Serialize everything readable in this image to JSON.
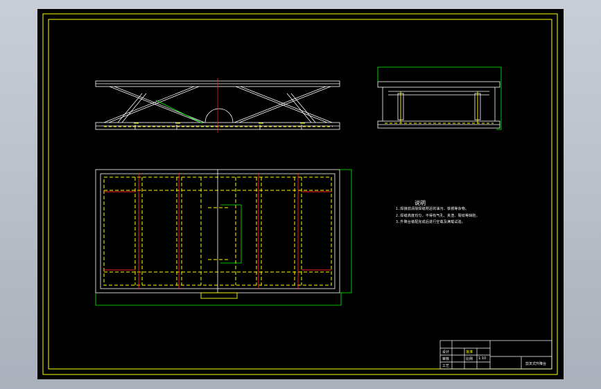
{
  "viewport": {
    "background": "#000000",
    "frame_color": "#ffff00"
  },
  "notes": {
    "title": "说明",
    "lines": [
      "1.焊接前清除焊缝附近的油污、铁锈等杂物。",
      "2.焊缝高度均匀，不得有气孔、夹渣、裂纹等缺陷。",
      "3.升降台装配完成后进行空载及满载试验。"
    ]
  },
  "title_block": {
    "cells": [
      "设计",
      "审核",
      "工艺",
      "批准",
      "比例",
      "1:10",
      "剪叉式升降台"
    ]
  },
  "colors": {
    "line": "#ffffff",
    "hidden": "#ffff00",
    "center": "#ff2020",
    "dim": "#00ff00"
  }
}
